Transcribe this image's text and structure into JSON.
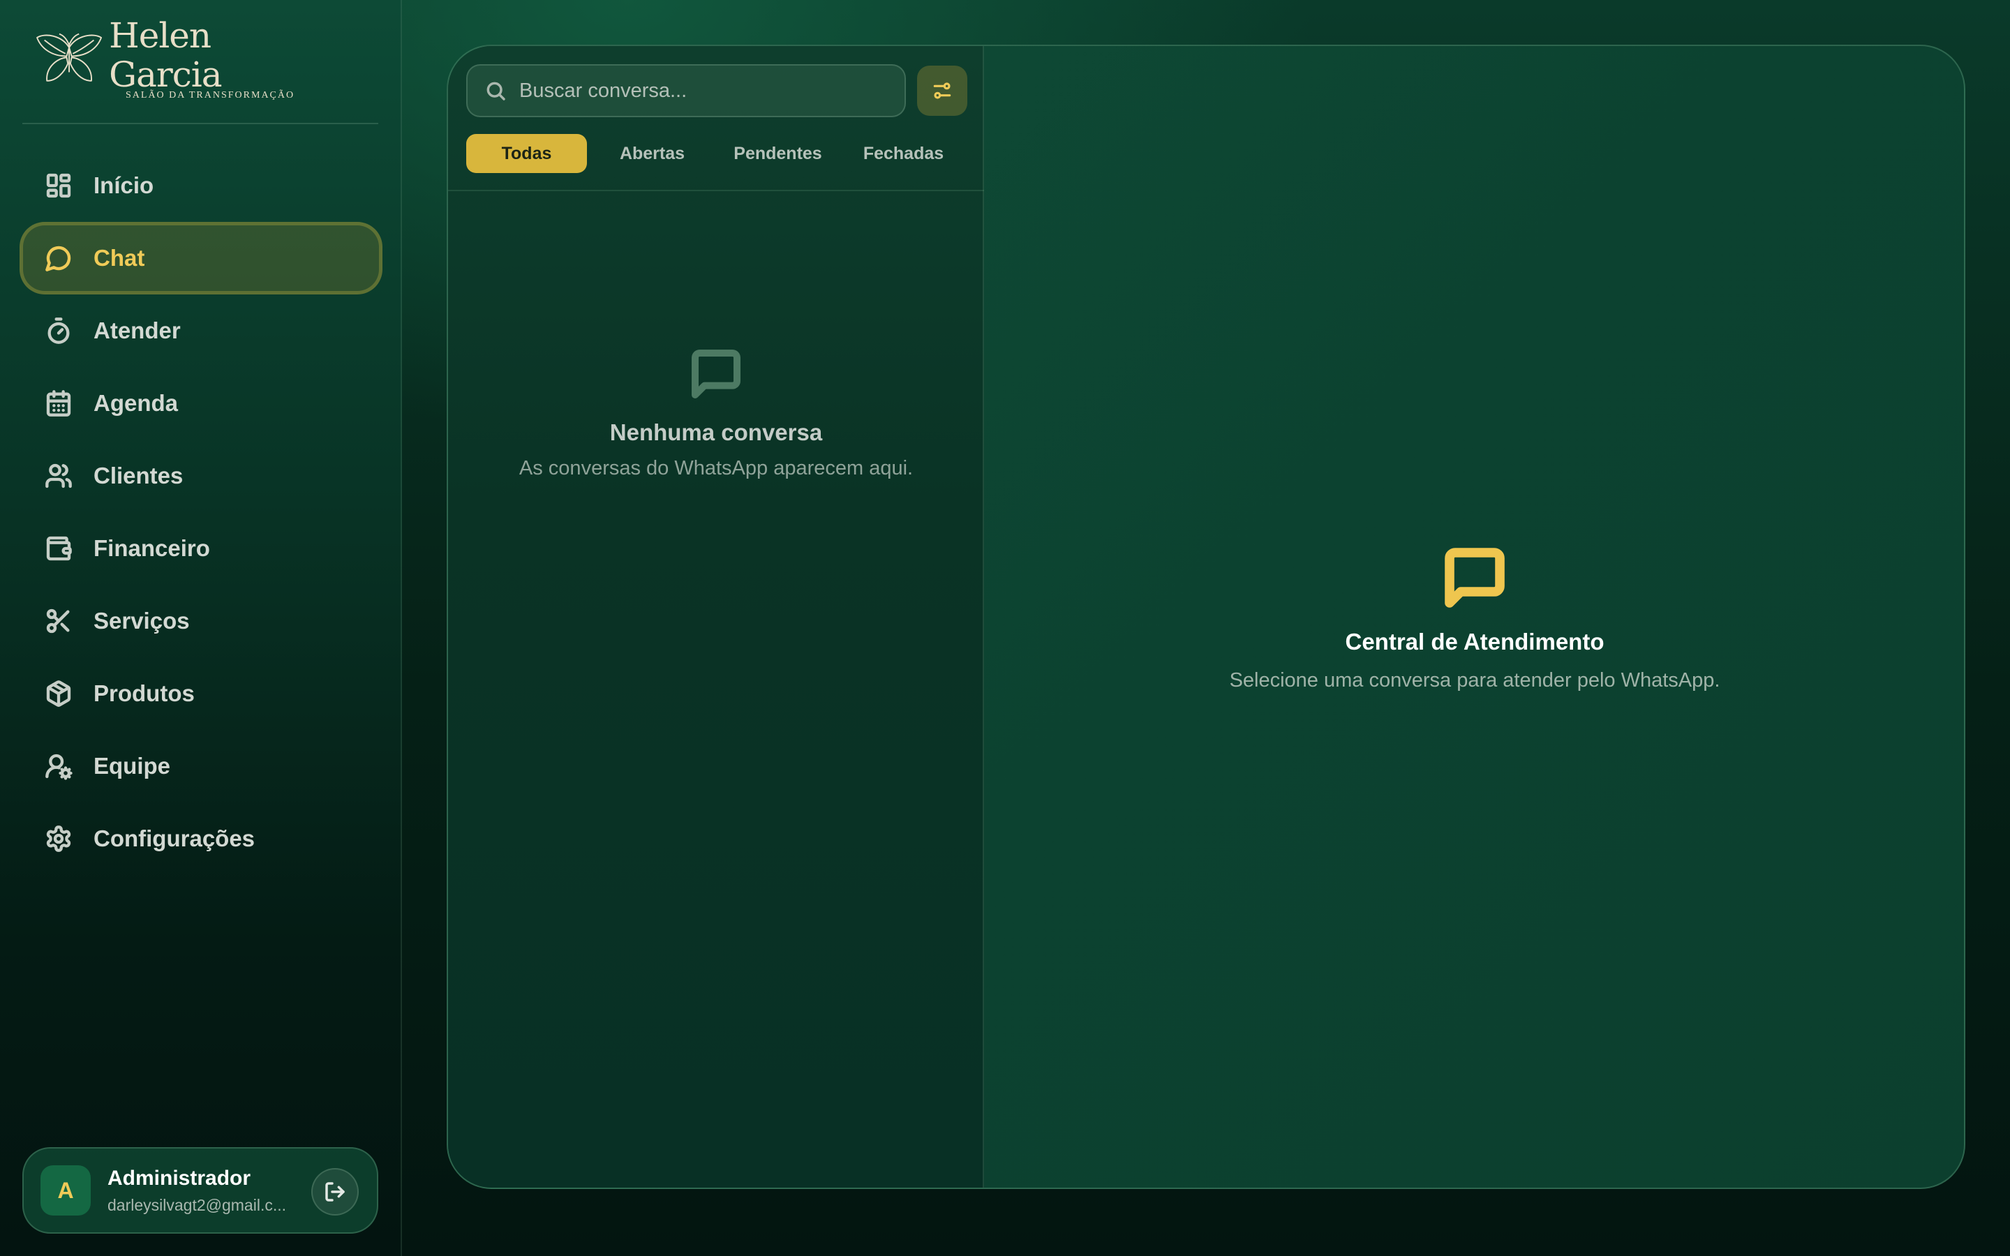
{
  "brand": {
    "name": "Helen Garcia",
    "tagline": "SALÃO DA TRANSFORMAÇÃO"
  },
  "sidebar": {
    "items": [
      {
        "label": "Início",
        "icon": "grid-icon"
      },
      {
        "label": "Chat",
        "icon": "chat-icon",
        "active": true
      },
      {
        "label": "Atender",
        "icon": "stopwatch-icon"
      },
      {
        "label": "Agenda",
        "icon": "calendar-icon"
      },
      {
        "label": "Clientes",
        "icon": "users-icon"
      },
      {
        "label": "Financeiro",
        "icon": "wallet-icon"
      },
      {
        "label": "Serviços",
        "icon": "scissors-icon"
      },
      {
        "label": "Produtos",
        "icon": "package-icon"
      },
      {
        "label": "Equipe",
        "icon": "user-gear-icon"
      },
      {
        "label": "Configurações",
        "icon": "gear-icon"
      }
    ]
  },
  "user": {
    "initial": "A",
    "name": "Administrador",
    "email": "darleysilvagt2@gmail.c..."
  },
  "conversations": {
    "search_placeholder": "Buscar conversa...",
    "tabs": [
      {
        "label": "Todas",
        "active": true
      },
      {
        "label": "Abertas"
      },
      {
        "label": "Pendentes"
      },
      {
        "label": "Fechadas"
      }
    ],
    "empty_title": "Nenhuma conversa",
    "empty_subtitle": "As conversas do WhatsApp aparecem aqui."
  },
  "detail": {
    "title": "Central de Atendimento",
    "subtitle": "Selecione uma conversa para atender pelo WhatsApp."
  },
  "colors": {
    "accent": "#f0cb58",
    "tab_active": "#d8b63c",
    "background": "#0a3a2a"
  }
}
